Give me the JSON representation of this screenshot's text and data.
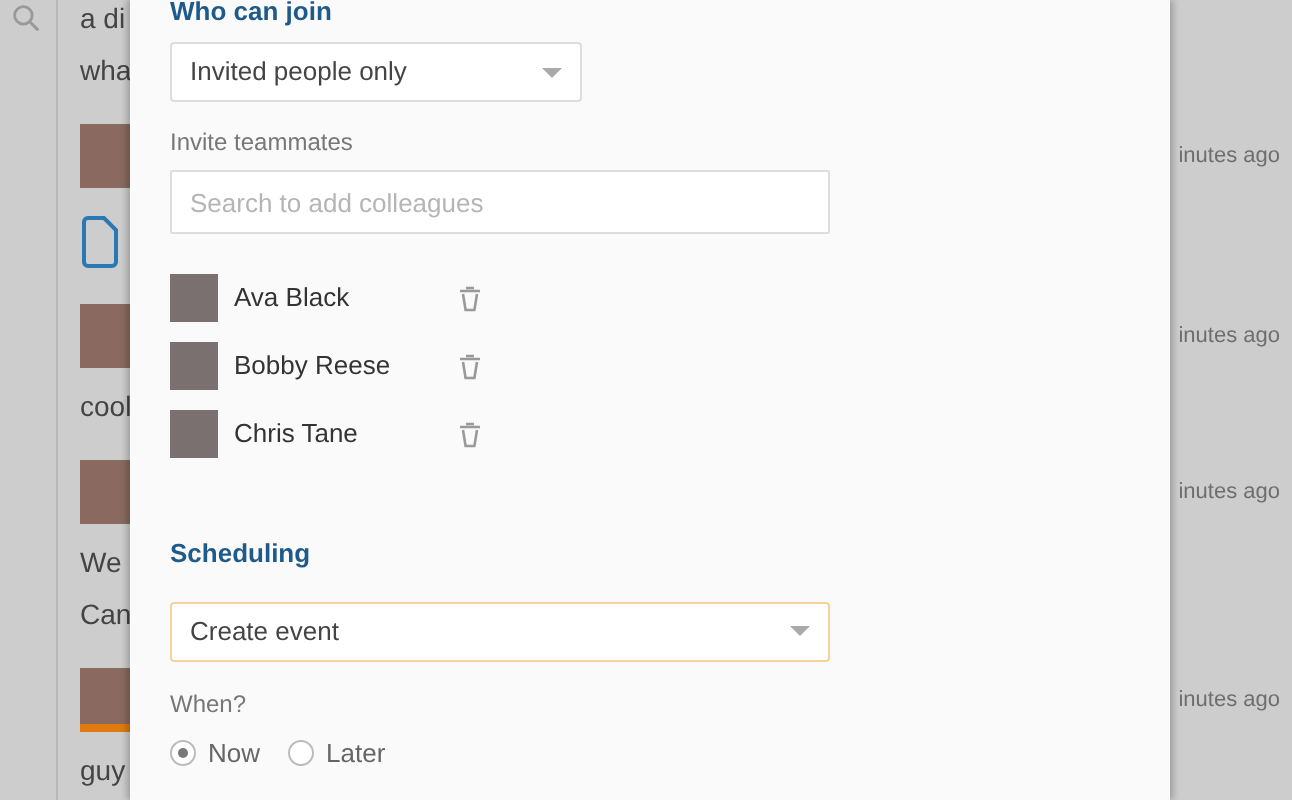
{
  "chat": {
    "items": [
      {
        "kind": "text",
        "text": "a di"
      },
      {
        "kind": "text",
        "text": "wha"
      },
      {
        "kind": "avatar",
        "time": "inutes ago",
        "highlighted": false
      },
      {
        "kind": "file"
      },
      {
        "kind": "avatar",
        "time": "inutes ago",
        "highlighted": false
      },
      {
        "kind": "text",
        "text": "cool"
      },
      {
        "kind": "avatar",
        "time": "inutes ago",
        "highlighted": false
      },
      {
        "kind": "text",
        "text": "We"
      },
      {
        "kind": "text",
        "text": "Can"
      },
      {
        "kind": "avatar",
        "time": "inutes ago",
        "highlighted": true
      },
      {
        "kind": "text",
        "text": "guy"
      }
    ]
  },
  "dialog": {
    "join_heading": "Who can join",
    "join_select": {
      "value": "Invited people only"
    },
    "invite_label": "Invite teammates",
    "invite_search": {
      "placeholder": "Search to add colleagues"
    },
    "members": [
      {
        "name": "Ava Black"
      },
      {
        "name": "Bobby Reese"
      },
      {
        "name": "Chris Tane"
      }
    ],
    "scheduling_heading": "Scheduling",
    "event_select": {
      "value": "Create event",
      "focused": true
    },
    "when_label": "When?",
    "when_options": [
      {
        "label": "Now",
        "selected": true
      },
      {
        "label": "Later",
        "selected": false
      }
    ]
  }
}
